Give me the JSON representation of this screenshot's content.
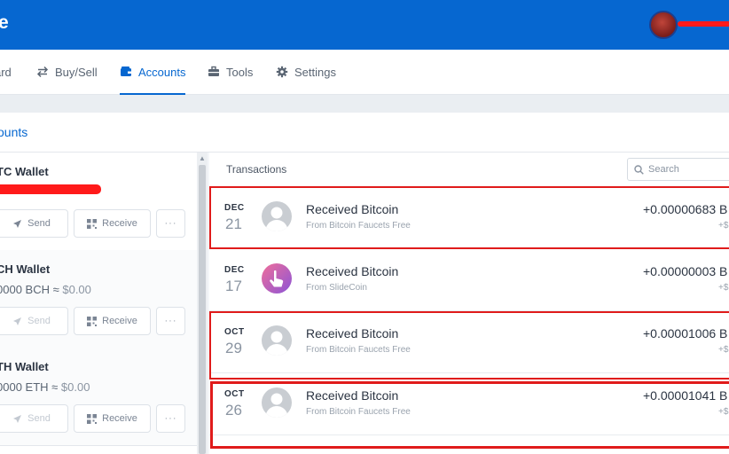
{
  "header": {
    "brand": "e",
    "colors": {
      "bar": "#0667d0",
      "redaction": "#ff1a1a"
    }
  },
  "nav": {
    "items": [
      {
        "label": "ard",
        "icon": "dashboard-icon",
        "active": false
      },
      {
        "label": "Buy/Sell",
        "icon": "swap-arrows-icon",
        "active": false
      },
      {
        "label": "Accounts",
        "icon": "wallet-icon",
        "active": true
      },
      {
        "label": "Tools",
        "icon": "toolbox-icon",
        "active": false
      },
      {
        "label": "Settings",
        "icon": "gear-icon",
        "active": false
      }
    ]
  },
  "page": {
    "title": "counts"
  },
  "wallets": [
    {
      "name": "TC Wallet",
      "balance": "",
      "fiat": "",
      "send_label": "Send",
      "receive_label": "Receive",
      "more_label": "···",
      "send_enabled": true
    },
    {
      "name": "CH Wallet",
      "balance": "0000 BCH ≈",
      "fiat": "$0.00",
      "send_label": "Send",
      "receive_label": "Receive",
      "more_label": "···",
      "send_enabled": false
    },
    {
      "name": "TH Wallet",
      "balance": "0000 ETH ≈",
      "fiat": "$0.00",
      "send_label": "Send",
      "receive_label": "Receive",
      "more_label": "···",
      "send_enabled": false
    }
  ],
  "transactions": {
    "title": "Transactions",
    "search_placeholder": "Search",
    "rows": [
      {
        "month": "DEC",
        "day": "21",
        "title": "Received Bitcoin",
        "from": "From Bitcoin Faucets Free",
        "amount": "+0.00000683 B",
        "fiat": "+$",
        "icon": "default-avatar-icon"
      },
      {
        "month": "DEC",
        "day": "17",
        "title": "Received Bitcoin",
        "from": "From SlideCoin",
        "amount": "+0.00000003 B",
        "fiat": "+$",
        "icon": "slidecoin-logo-icon"
      },
      {
        "month": "OCT",
        "day": "29",
        "title": "Received Bitcoin",
        "from": "From Bitcoin Faucets Free",
        "amount": "+0.00001006 B",
        "fiat": "+$",
        "icon": "default-avatar-icon"
      },
      {
        "month": "OCT",
        "day": "26",
        "title": "Received Bitcoin",
        "from": "From Bitcoin Faucets Free",
        "amount": "+0.00001041 B",
        "fiat": "+$",
        "icon": "default-avatar-icon"
      }
    ]
  }
}
